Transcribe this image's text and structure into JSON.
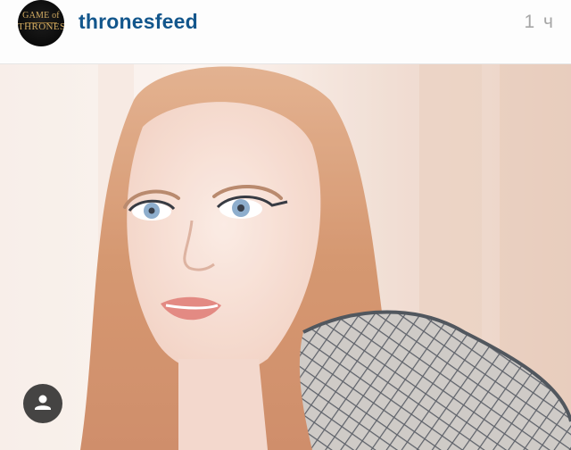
{
  "post": {
    "account": {
      "username": "thronesfeed",
      "avatar_logo_lines": [
        "GAME of",
        "THRONES"
      ],
      "avatar_colors": {
        "background": "#0b0b0b",
        "text": "#d4ad63"
      }
    },
    "timestamp": "1 ч",
    "photo": {
      "icon": "portrait-photo"
    },
    "tag_button": {
      "icon": "person-icon"
    },
    "colors": {
      "username": "#12568c",
      "timestamp": "#a6a6a6"
    }
  }
}
